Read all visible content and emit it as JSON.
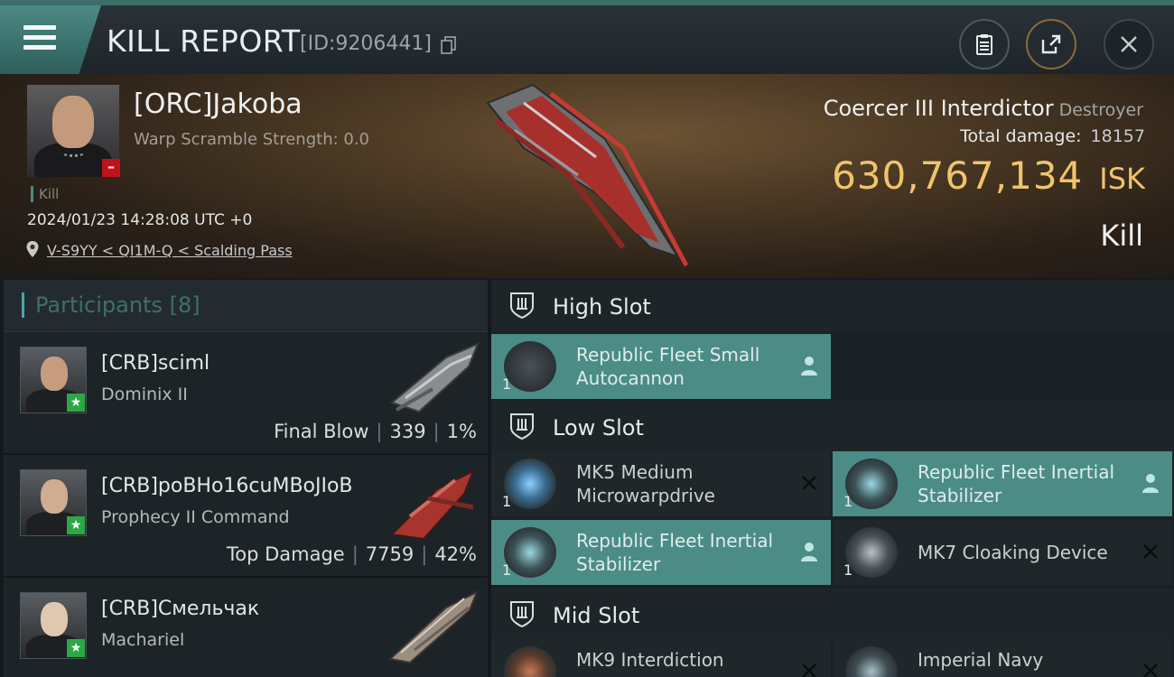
{
  "header": {
    "title": "KILL REPORT",
    "report_id": "[ID:9206441]",
    "buttons": [
      "clipboard-icon",
      "share-icon",
      "close-icon"
    ]
  },
  "victim": {
    "name": "[ORC]Jakoba",
    "warp_scramble": "Warp Scramble Strength: 0.0",
    "kill_tag": "Kill",
    "timestamp": "2024/01/23 14:28:08 UTC +0",
    "location": "V-S9YY < QI1M-Q < Scalding Pass",
    "ship_name": "Coercer III Interdictor",
    "ship_class": "Destroyer",
    "total_damage_label": "Total damage:",
    "total_damage": "18157",
    "isk_value": "630,767,134",
    "isk_unit": "ISK",
    "result": "Kill"
  },
  "participants": {
    "title": "Participants [8]",
    "rows": [
      {
        "name": "[CRB]sciml",
        "ship": "Dominix II",
        "tag": "Final Blow",
        "damage": "339",
        "percent": "1%"
      },
      {
        "name": "[CRB]poBHo16cuMBoJIoB",
        "ship": "Prophecy II Command",
        "tag": "Top Damage",
        "damage": "7759",
        "percent": "42%"
      },
      {
        "name": "[CRB]Смельчак",
        "ship": "Machariel",
        "tag": "",
        "damage": "",
        "percent": ""
      }
    ]
  },
  "fitting": {
    "high_slot": {
      "label": "High Slot",
      "modules": [
        {
          "name": "Republic Fleet Small Autocannon",
          "qty": "1",
          "highlighted": true
        }
      ]
    },
    "low_slot": {
      "label": "Low Slot",
      "modules": [
        {
          "name": "MK5 Medium Microwarpdrive",
          "qty": "1",
          "highlighted": false
        },
        {
          "name": "Republic Fleet Inertial Stabilizer",
          "qty": "1",
          "highlighted": true
        },
        {
          "name": "Republic Fleet Inertial Stabilizer",
          "qty": "1",
          "highlighted": true
        },
        {
          "name": "MK7 Cloaking Device",
          "qty": "1",
          "highlighted": false
        }
      ]
    },
    "mid_slot": {
      "label": "Mid Slot",
      "modules": [
        {
          "name": "MK9 Interdiction",
          "qty": "",
          "highlighted": false
        },
        {
          "name": "Imperial Navy",
          "qty": "",
          "highlighted": false
        }
      ]
    }
  },
  "colors": {
    "accent": "#4b8c86",
    "isk_gold": "#f0c46c",
    "star_green": "#2aa844",
    "minus_red": "#c0121a"
  }
}
